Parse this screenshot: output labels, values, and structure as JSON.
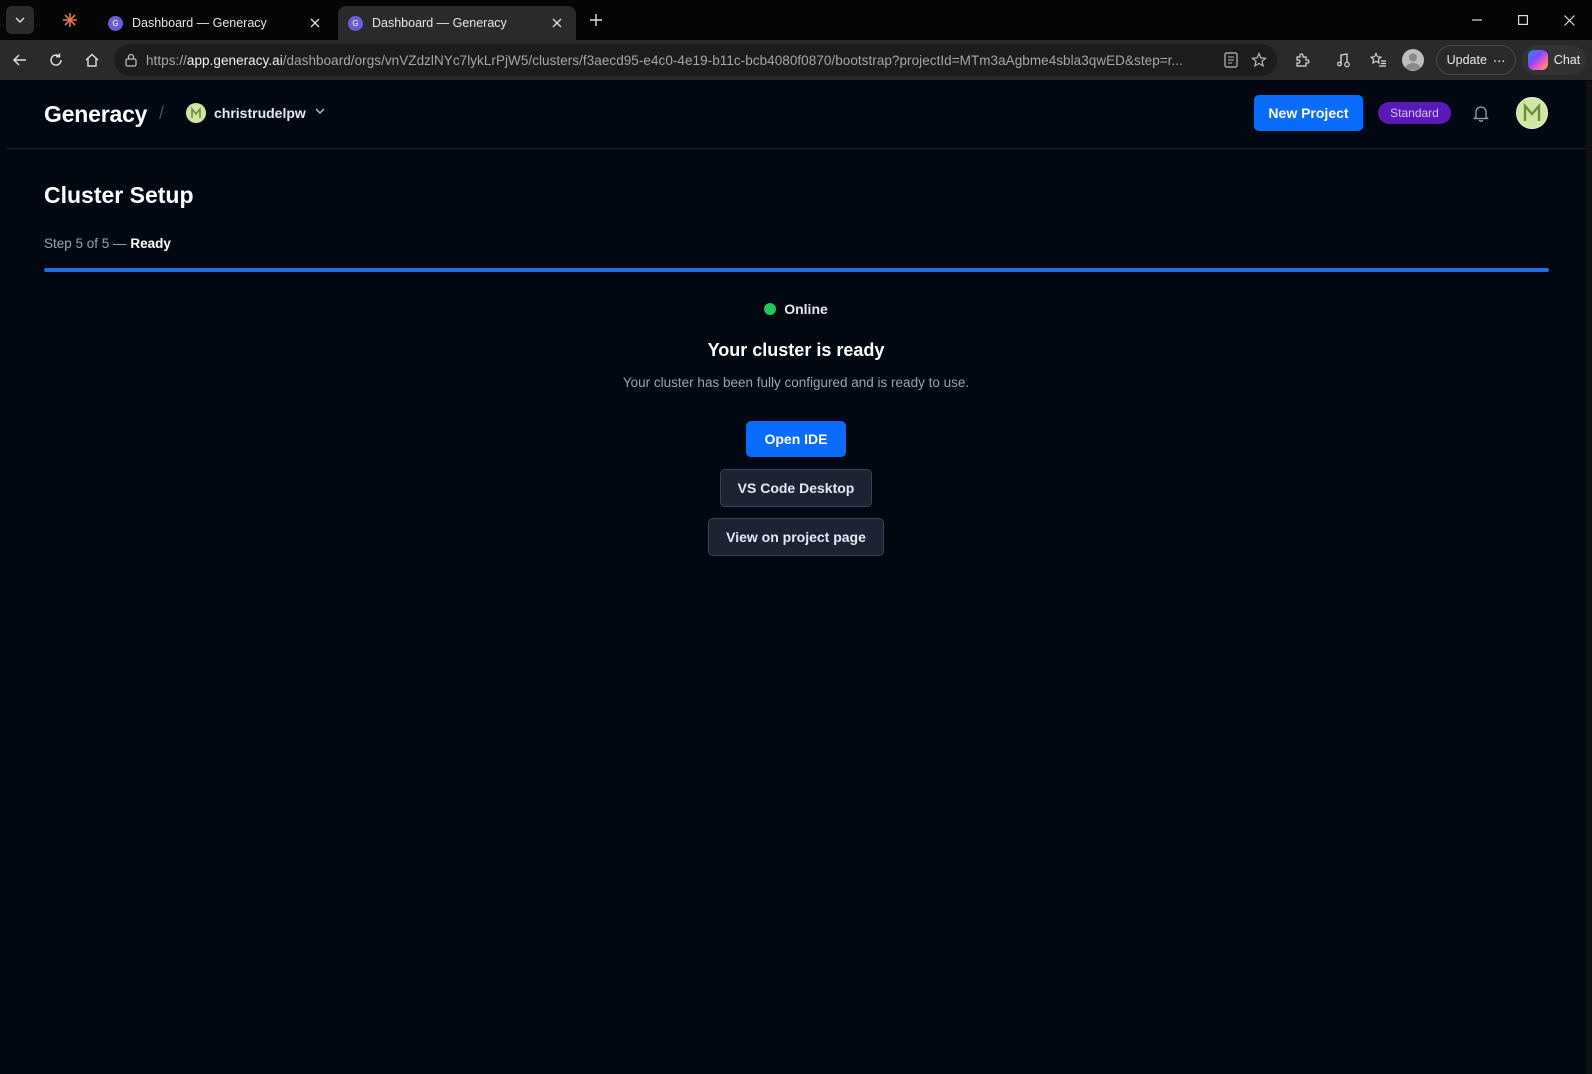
{
  "browser": {
    "tabs": [
      {
        "title": "Dashboard — Generacy",
        "favicon_letter": "G",
        "active": false
      },
      {
        "title": "Dashboard — Generacy",
        "favicon_letter": "G",
        "active": true
      }
    ],
    "url": {
      "scheme": "https://",
      "host": "app.generacy.ai",
      "path": "/dashboard/orgs/vnVZdzlNYc7lykLrPjW5/clusters/f3aecd95-e4c0-4e19-b11c-bcb4080f0870/bootstrap?projectId=MTm3aAgbme4sbla3qwED&step=r..."
    },
    "update_label": "Update",
    "chat_label": "Chat"
  },
  "header": {
    "brand": "Generacy",
    "separator": "/",
    "org_name": "christrudelpw",
    "new_project_label": "New Project",
    "plan_badge": "Standard"
  },
  "setup": {
    "title": "Cluster Setup",
    "step_prefix": "Step 5 of 5 —",
    "step_status": "Ready",
    "progress_fraction": 1.0
  },
  "result": {
    "status_label": "Online",
    "status_color": "#22c55e",
    "heading": "Your cluster is ready",
    "description": "Your cluster has been fully configured and is ready to use.",
    "open_ide_label": "Open IDE",
    "vscode_label": "VS Code Desktop",
    "project_page_label": "View on project page"
  },
  "colors": {
    "accent": "#0a6cff",
    "badge_bg": "#5a1ab8",
    "background": "#020812"
  }
}
